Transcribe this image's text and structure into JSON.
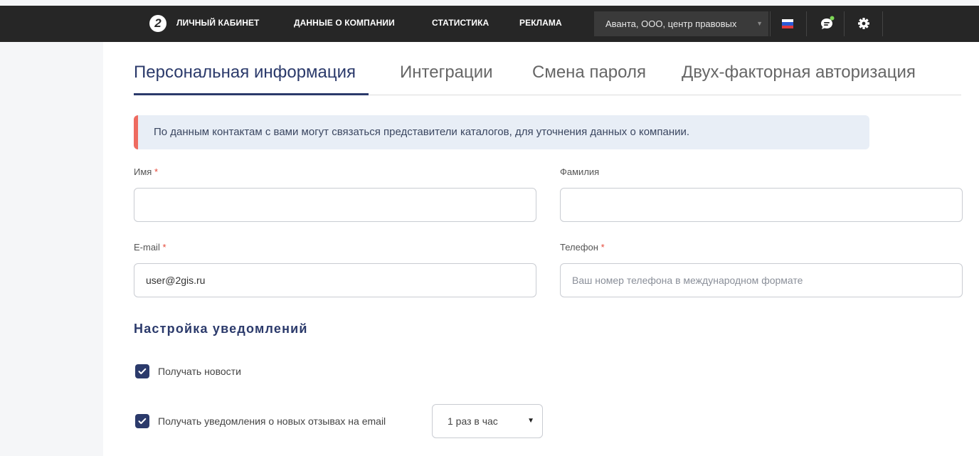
{
  "topbar": {
    "logo_text": "2",
    "nav": [
      "ЛИЧНЫЙ КАБИНЕТ",
      "ДАННЫЕ О КОМПАНИИ",
      "СТАТИСТИКА",
      "РЕКЛАМА"
    ],
    "company": "Аванта, ООО, центр правовых",
    "language_icon": "flag-ru-icon",
    "chat_icon": "chat-icon",
    "settings_icon": "gear-icon",
    "chat_status_color": "#7ed957"
  },
  "tabs": [
    "Персональная информация",
    "Интеграции",
    "Смена пароля",
    "Двух-факторная авторизация"
  ],
  "active_tab": 0,
  "alert": {
    "text": "По данным контактам с вами могут связаться представители каталогов, для уточнения данных о компании.",
    "accent_color": "#ee6b60"
  },
  "form": {
    "first_name": {
      "label": "Имя",
      "required": "*",
      "value": ""
    },
    "last_name": {
      "label": "Фамилия",
      "value": ""
    },
    "email": {
      "label": "E-mail",
      "required": "*",
      "value": "user@2gis.ru"
    },
    "phone": {
      "label": "Телефон",
      "required": "*",
      "value": "",
      "placeholder": "Ваш номер телефона в международном формате"
    }
  },
  "notifications": {
    "title": "Настройка уведомлений",
    "news": {
      "label": "Получать новости",
      "checked": true
    },
    "reviews": {
      "label": "Получать уведомления о новых отзывах на email",
      "checked": true
    },
    "frequency": {
      "selected": "1 раз в час"
    }
  },
  "colors": {
    "accent": "#2b3a6b",
    "topbar": "#262626"
  }
}
